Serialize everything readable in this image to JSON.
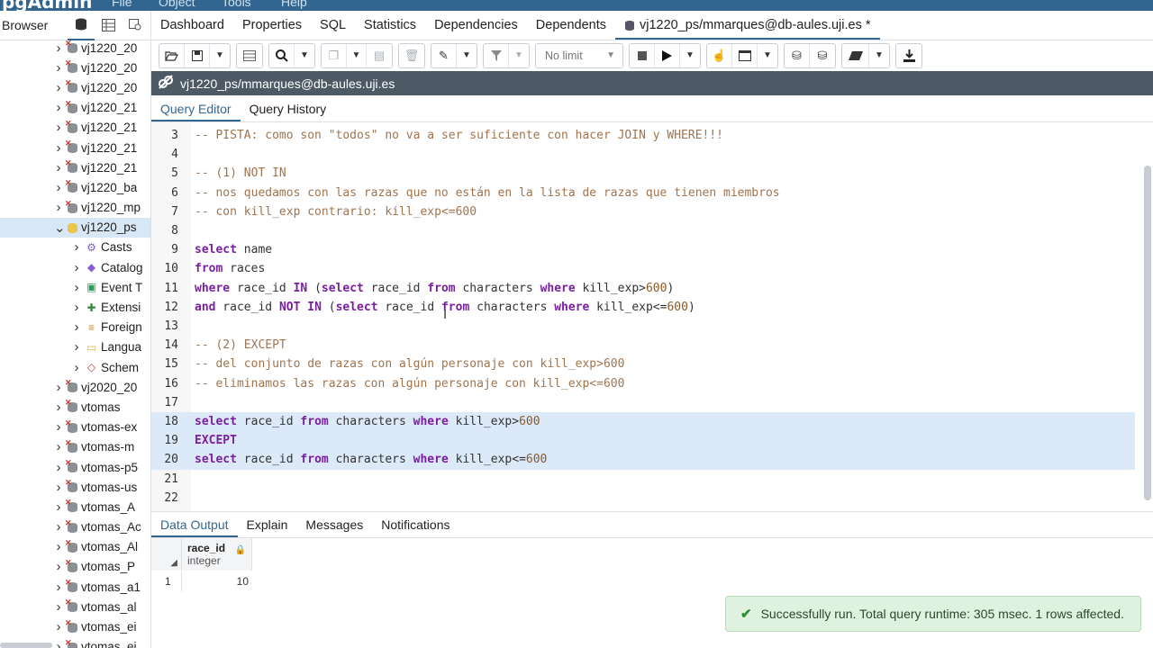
{
  "app": {
    "menu": [
      "File",
      "Object",
      "Tools",
      "Help"
    ]
  },
  "sidebar": {
    "title": "Browser",
    "items": [
      {
        "label": "vj1220_20",
        "kind": "db-x"
      },
      {
        "label": "vj1220_20",
        "kind": "db-x"
      },
      {
        "label": "vj1220_20",
        "kind": "db-x"
      },
      {
        "label": "vj1220_21",
        "kind": "db-x"
      },
      {
        "label": "vj1220_21",
        "kind": "db-x"
      },
      {
        "label": "vj1220_21",
        "kind": "db-x"
      },
      {
        "label": "vj1220_21",
        "kind": "db-x"
      },
      {
        "label": "vj1220_ba",
        "kind": "db-x"
      },
      {
        "label": "vj1220_mp",
        "kind": "db-x"
      },
      {
        "label": "vj1220_ps",
        "kind": "db-open"
      },
      {
        "label": "Casts",
        "kind": "child",
        "icon": "⚙",
        "color": "#7a5fc4"
      },
      {
        "label": "Catalog",
        "kind": "child",
        "icon": "◆",
        "color": "#8a5fd0"
      },
      {
        "label": "Event T",
        "kind": "child",
        "icon": "▣",
        "color": "#2f9a5a"
      },
      {
        "label": "Extensi",
        "kind": "child",
        "icon": "✚",
        "color": "#2f8a3a"
      },
      {
        "label": "Foreign",
        "kind": "child",
        "icon": "≡",
        "color": "#c98a2b"
      },
      {
        "label": "Langua",
        "kind": "child",
        "icon": "▭",
        "color": "#d9b82b"
      },
      {
        "label": "Schem",
        "kind": "child",
        "icon": "◇",
        "color": "#c0392b"
      },
      {
        "label": "vj2020_20",
        "kind": "db-x"
      },
      {
        "label": "vtomas",
        "kind": "db-x"
      },
      {
        "label": "vtomas-ex",
        "kind": "db-x"
      },
      {
        "label": "vtomas-m",
        "kind": "db-x"
      },
      {
        "label": "vtomas-p5",
        "kind": "db-x"
      },
      {
        "label": "vtomas-us",
        "kind": "db-x"
      },
      {
        "label": "vtomas_A",
        "kind": "db-x"
      },
      {
        "label": "vtomas_Ac",
        "kind": "db-x"
      },
      {
        "label": "vtomas_Al",
        "kind": "db-x"
      },
      {
        "label": "vtomas_P",
        "kind": "db-x"
      },
      {
        "label": "vtomas_a1",
        "kind": "db-x"
      },
      {
        "label": "vtomas_al",
        "kind": "db-x"
      },
      {
        "label": "vtomas_ei",
        "kind": "db-x"
      },
      {
        "label": "vtomas_ei",
        "kind": "db-x"
      }
    ]
  },
  "tabs": {
    "dashboard": "Dashboard",
    "properties": "Properties",
    "sql": "SQL",
    "statistics": "Statistics",
    "dependencies": "Dependencies",
    "dependents": "Dependents",
    "query": "vj1220_ps/mmarques@db-aules.uji.es *"
  },
  "toolbar": {
    "limit": "No limit"
  },
  "connection": "vj1220_ps/mmarques@db-aules.uji.es",
  "query_tabs": {
    "editor": "Query Editor",
    "history": "Query History"
  },
  "editor": {
    "lines": [
      {
        "n": "3",
        "text": "-- PISTA: como son \"todos\" no va a ser suficiente con hacer JOIN y WHERE!!!"
      },
      {
        "n": "4",
        "text": ""
      },
      {
        "n": "5",
        "text": "-- (1) NOT IN"
      },
      {
        "n": "6",
        "text": "-- nos quedamos con las razas que no están en la lista de razas que tienen miembros"
      },
      {
        "n": "7",
        "text": "-- con kill_exp contrario: kill_exp<=600"
      },
      {
        "n": "8",
        "text": ""
      },
      {
        "n": "9",
        "text": "select name"
      },
      {
        "n": "10",
        "text": "from races"
      },
      {
        "n": "11",
        "text": "where race_id IN (select race_id from characters where kill_exp>600)"
      },
      {
        "n": "12",
        "text": "and race_id NOT IN (select race_id from characters where kill_exp<=600)"
      },
      {
        "n": "13",
        "text": ""
      },
      {
        "n": "14",
        "text": "-- (2) EXCEPT"
      },
      {
        "n": "15",
        "text": "-- del conjunto de razas con algún personaje con kill_exp>600"
      },
      {
        "n": "16",
        "text": "-- eliminamos las razas con algún personaje con kill_exp<=600"
      },
      {
        "n": "17",
        "text": ""
      },
      {
        "n": "18",
        "text": "select race_id from characters where kill_exp>600"
      },
      {
        "n": "19",
        "text": "EXCEPT"
      },
      {
        "n": "20",
        "text": "select race_id from characters where kill_exp<=600"
      },
      {
        "n": "21",
        "text": ""
      },
      {
        "n": "22",
        "text": ""
      }
    ]
  },
  "output_tabs": {
    "data": "Data Output",
    "explain": "Explain",
    "messages": "Messages",
    "notifications": "Notifications"
  },
  "grid": {
    "column": {
      "name": "race_id",
      "type": "integer"
    },
    "rows": [
      {
        "num": "1",
        "value": "10"
      }
    ]
  },
  "toast": "Successfully run. Total query runtime: 305 msec. 1 rows affected.",
  "colors": {
    "accent": "#326690",
    "selection": "#dbe9f8",
    "toast_bg": "#dff1df"
  }
}
